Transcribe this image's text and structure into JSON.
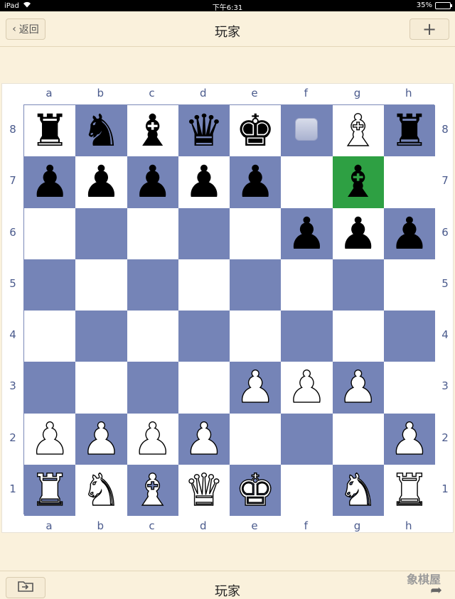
{
  "status_bar": {
    "device": "iPad",
    "time": "下午6:31",
    "battery": "35%",
    "battery_level": 0.35
  },
  "nav": {
    "back_label": "返回",
    "title": "玩家",
    "add_label": "+"
  },
  "bottom": {
    "title": "玩家",
    "watermark": "象棋屋"
  },
  "board": {
    "files": [
      "a",
      "b",
      "c",
      "d",
      "e",
      "f",
      "g",
      "h"
    ],
    "ranks": [
      "8",
      "7",
      "6",
      "5",
      "4",
      "3",
      "2",
      "1"
    ],
    "highlight_square": "g7",
    "marker_square": "f8",
    "pieces": [
      {
        "square": "a8",
        "color": "black",
        "type": "rook"
      },
      {
        "square": "b8",
        "color": "black",
        "type": "knight"
      },
      {
        "square": "c8",
        "color": "black",
        "type": "bishop"
      },
      {
        "square": "d8",
        "color": "black",
        "type": "queen"
      },
      {
        "square": "e8",
        "color": "black",
        "type": "king"
      },
      {
        "square": "g8",
        "color": "white",
        "type": "bishop"
      },
      {
        "square": "h8",
        "color": "black",
        "type": "rook"
      },
      {
        "square": "a7",
        "color": "black",
        "type": "pawn"
      },
      {
        "square": "b7",
        "color": "black",
        "type": "pawn"
      },
      {
        "square": "c7",
        "color": "black",
        "type": "pawn"
      },
      {
        "square": "d7",
        "color": "black",
        "type": "pawn"
      },
      {
        "square": "e7",
        "color": "black",
        "type": "pawn"
      },
      {
        "square": "g7",
        "color": "black",
        "type": "bishop"
      },
      {
        "square": "f6",
        "color": "black",
        "type": "pawn"
      },
      {
        "square": "g6",
        "color": "black",
        "type": "pawn"
      },
      {
        "square": "h6",
        "color": "black",
        "type": "pawn"
      },
      {
        "square": "e3",
        "color": "white",
        "type": "pawn"
      },
      {
        "square": "f3",
        "color": "white",
        "type": "pawn"
      },
      {
        "square": "g3",
        "color": "white",
        "type": "pawn"
      },
      {
        "square": "a2",
        "color": "white",
        "type": "pawn"
      },
      {
        "square": "b2",
        "color": "white",
        "type": "pawn"
      },
      {
        "square": "c2",
        "color": "white",
        "type": "pawn"
      },
      {
        "square": "d2",
        "color": "white",
        "type": "pawn"
      },
      {
        "square": "h2",
        "color": "white",
        "type": "pawn"
      },
      {
        "square": "a1",
        "color": "white",
        "type": "rook"
      },
      {
        "square": "b1",
        "color": "white",
        "type": "knight"
      },
      {
        "square": "c1",
        "color": "white",
        "type": "bishop"
      },
      {
        "square": "d1",
        "color": "white",
        "type": "queen"
      },
      {
        "square": "e1",
        "color": "white",
        "type": "king"
      },
      {
        "square": "g1",
        "color": "white",
        "type": "knight"
      },
      {
        "square": "h1",
        "color": "white",
        "type": "rook"
      }
    ]
  },
  "colors": {
    "light_square": "#ffffff",
    "dark_square": "#7584b7",
    "highlight": "#2ea043",
    "background": "#faf1dc"
  }
}
